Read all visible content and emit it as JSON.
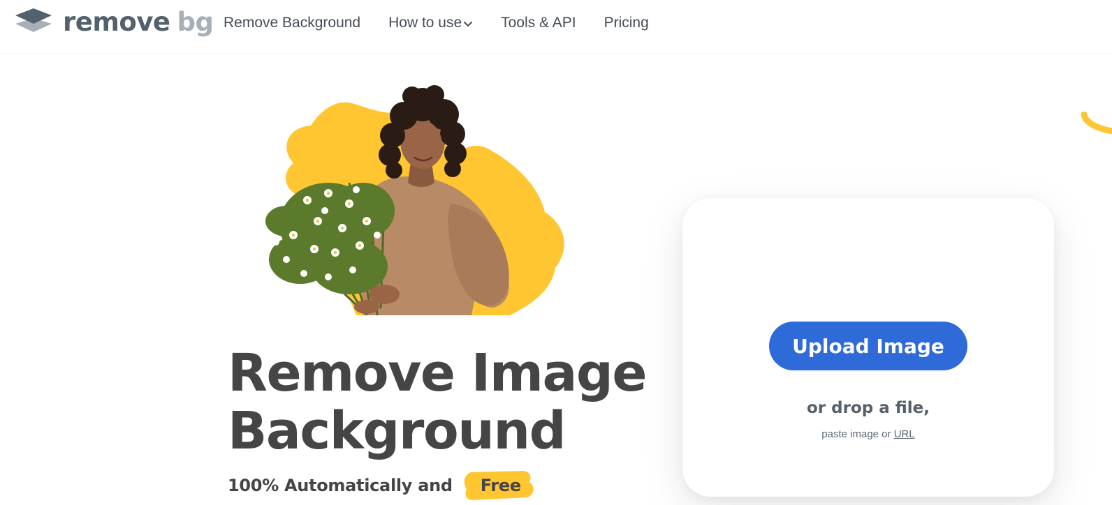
{
  "brand": {
    "logo_word1": "remove",
    "logo_word2": "bg",
    "logo_icon": "stacked-layers-icon",
    "colors": {
      "primary": "#54616c",
      "secondary": "#a7b0b8",
      "accent_yellow": "#ffc632",
      "button_blue": "#2f6ad9"
    }
  },
  "nav": {
    "items": [
      {
        "label": "Remove Background"
      },
      {
        "label": "How to use",
        "icon": "chevron-down-icon"
      },
      {
        "label": "Tools & API"
      },
      {
        "label": "Pricing"
      }
    ]
  },
  "hero": {
    "image_alt": "Woman holding a bouquet of wildflowers in front of a yellow shape",
    "title_line1": "Remove Image",
    "title_line2": "Background",
    "subtitle_prefix": "100% Automatically and",
    "subtitle_highlight": "Free"
  },
  "upload": {
    "button_label": "Upload Image",
    "drop_text": "or drop a file,",
    "paste_text": "paste image or",
    "url_label": "URL"
  }
}
